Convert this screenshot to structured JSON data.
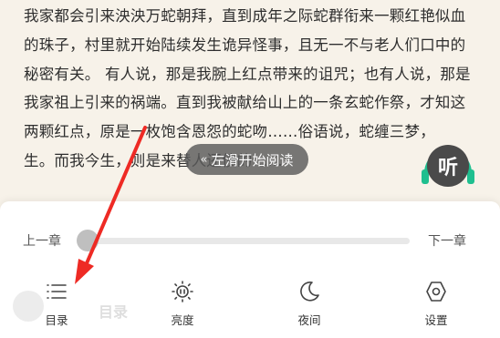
{
  "reader": {
    "lines": [
      "我家都会引来泱泱万蛇朝拜，直到成年之际蛇群衔来一颗红艳似血",
      "的珠子，村里就开始陆续发生诡异怪事，且无一不与老人们口中的",
      "秘密有关。 有人说，那是我腕上红点带来的诅咒；也有人说，那是",
      "我家祖上引来的祸端。直到我被献给山上的一条玄蛇作祭，才知这",
      "两颗红点，原是一枚饱含恩怨的蛇吻……俗语说，蛇缠三梦，",
      "生。而我今生，则是来替人还债的……"
    ]
  },
  "toast": {
    "chevrons": "«",
    "text": "左滑开始阅读"
  },
  "listen_button": {
    "label": "听",
    "accent": "#1fbf8f",
    "icon": "headphones-icon"
  },
  "chapter_nav": {
    "prev": "上一章",
    "next": "下一章",
    "progress": 0
  },
  "ghost_text": "目录",
  "menu": [
    {
      "label": "目录",
      "icon": "list-icon"
    },
    {
      "label": "亮度",
      "icon": "brightness-icon"
    },
    {
      "label": "夜间",
      "icon": "moon-icon"
    },
    {
      "label": "设置",
      "icon": "hexagon-settings-icon"
    }
  ],
  "annotation": {
    "arrow_color": "#ee2a24"
  }
}
